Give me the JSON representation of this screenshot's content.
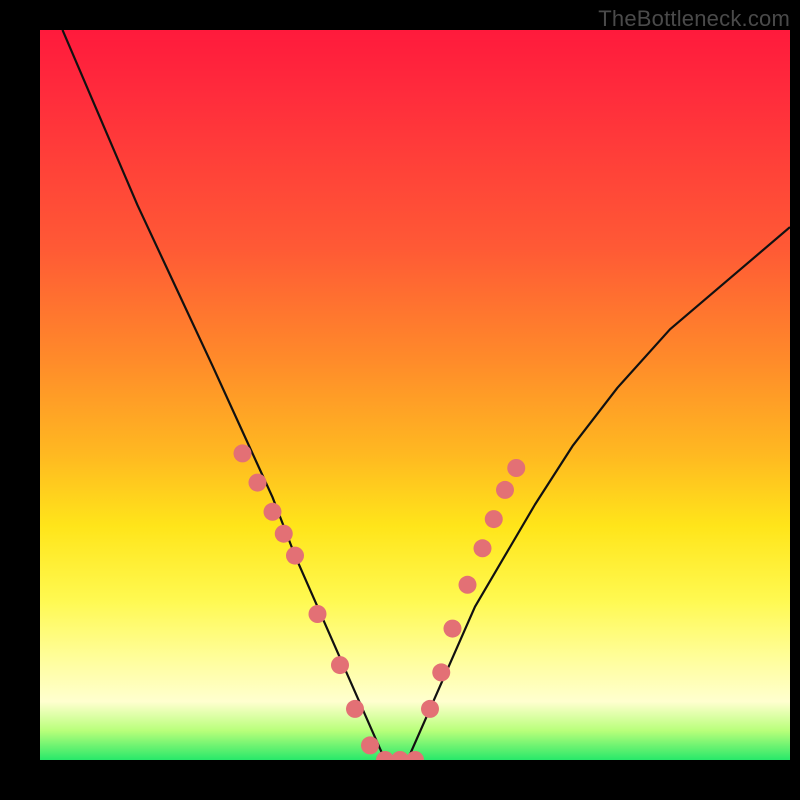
{
  "watermark": "TheBottleneck.com",
  "chart_data": {
    "type": "line",
    "title": "",
    "xlabel": "",
    "ylabel": "",
    "xlim": [
      0,
      100
    ],
    "ylim": [
      0,
      100
    ],
    "grid": false,
    "legend": false,
    "note": "Axes are unlabelled. Gradient encodes value from high bottleneck (red, top) to low (green, bottom). Curve is a V-shape minimized near x≈46 at y≈0.",
    "series": [
      {
        "name": "curve",
        "color": "#111111",
        "x": [
          3,
          8,
          13,
          18,
          23,
          27,
          31,
          34,
          37,
          40,
          43,
          46,
          49,
          52,
          55,
          58,
          62,
          66,
          71,
          77,
          84,
          92,
          100
        ],
        "y": [
          100,
          88,
          76,
          65,
          54,
          45,
          36,
          28,
          21,
          14,
          7,
          0,
          0,
          7,
          14,
          21,
          28,
          35,
          43,
          51,
          59,
          66,
          73
        ]
      }
    ],
    "scatter": {
      "name": "dots",
      "color": "#e37075",
      "radius": 9,
      "x": [
        27,
        29,
        31,
        32.5,
        34,
        37,
        40,
        42,
        44,
        46,
        48,
        50,
        52,
        53.5,
        55,
        57,
        59,
        60.5,
        62,
        63.5
      ],
      "y": [
        42,
        38,
        34,
        31,
        28,
        20,
        13,
        7,
        2,
        0,
        0,
        0,
        7,
        12,
        18,
        24,
        29,
        33,
        37,
        40
      ]
    }
  }
}
